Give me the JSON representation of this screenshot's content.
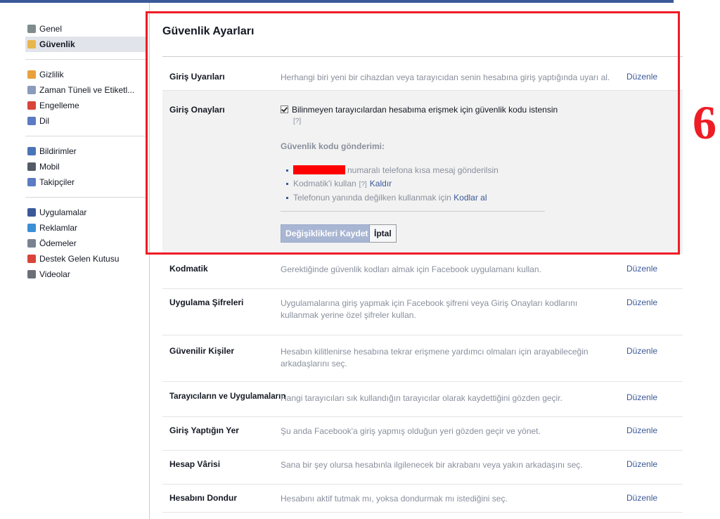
{
  "sidebar": {
    "groups": [
      [
        {
          "label": "Genel",
          "icon": "gears-icon",
          "color": "#7f8c8d",
          "selected": false
        },
        {
          "label": "Güvenlik",
          "icon": "shield-icon",
          "color": "#e9b64d",
          "selected": true
        }
      ],
      [
        {
          "label": "Gizlilik",
          "icon": "lock-icon",
          "color": "#e9a23b",
          "selected": false
        },
        {
          "label": "Zaman Tüneli ve Etiketl...",
          "icon": "timeline-icon",
          "color": "#8a9bbd",
          "selected": false
        },
        {
          "label": "Engelleme",
          "icon": "block-icon",
          "color": "#d9443a",
          "selected": false
        },
        {
          "label": "Dil",
          "icon": "globe-icon",
          "color": "#5b7bc2",
          "selected": false
        }
      ],
      [
        {
          "label": "Bildirimler",
          "icon": "globe-notify-icon",
          "color": "#4a76b8",
          "selected": false
        },
        {
          "label": "Mobil",
          "icon": "mobile-icon",
          "color": "#555b66",
          "selected": false
        },
        {
          "label": "Takipçiler",
          "icon": "rss-icon",
          "color": "#5b7bc2",
          "selected": false
        }
      ],
      [
        {
          "label": "Uygulamalar",
          "icon": "apps-icon",
          "color": "#3b5998",
          "selected": false
        },
        {
          "label": "Reklamlar",
          "icon": "ads-icon",
          "color": "#3b8fd6",
          "selected": false
        },
        {
          "label": "Ödemeler",
          "icon": "payments-icon",
          "color": "#7a8290",
          "selected": false
        },
        {
          "label": "Destek Gelen Kutusu",
          "icon": "lifebuoy-icon",
          "color": "#d9443a",
          "selected": false
        },
        {
          "label": "Videolar",
          "icon": "video-icon",
          "color": "#6a6f78",
          "selected": false
        }
      ]
    ]
  },
  "main": {
    "title": "Güvenlik Ayarları",
    "edit_label": "Düzenle",
    "rows_top": [
      {
        "label": "Giriş Uyarıları",
        "desc": "Herhangi biri yeni bir cihazdan veya tarayıcıdan senin hesabına giriş yaptığında uyarı al."
      }
    ],
    "expanded": {
      "label": "Giriş Onayları",
      "checkbox_label": "Bilinmeyen tarayıcılardan hesabıma erişmek için güvenlik kodu istensin",
      "help": "[?]",
      "sub_title": "Güvenlik kodu gönderimi:",
      "phone_text": "numaralı telefona kısa mesaj gönderilsin",
      "kodmatik_text": "Kodmatik'i kullan",
      "kodmatik_help": "[?]",
      "remove_link": "Kaldır",
      "codes_text": "Telefonun yanında değilken kullanmak için",
      "codes_link": "Kodlar al",
      "save_button": "Değişiklikleri Kaydet",
      "cancel_button": "İptal"
    },
    "rows": [
      {
        "label": "Kodmatik",
        "desc": "Gerektiğinde güvenlik kodları almak için Facebook uygulamanı kullan."
      },
      {
        "label": "Uygulama Şifreleri",
        "desc": "Uygulamalarına giriş yapmak için Facebook şifreni veya Giriş Onayları kodlarını kullanmak yerine özel şifreler kullan."
      },
      {
        "label": "Güvenilir Kişiler",
        "desc": "Hesabın kilitlenirse hesabına tekrar erişmene yardımcı olmaları için arayabileceğin arkadaşlarını seç."
      },
      {
        "label": "Tarayıcıların ve Uygulamaların",
        "desc": "Hangi tarayıcıları sık kullandığın tarayıcılar olarak kaydettiğini gözden geçir."
      },
      {
        "label": "Giriş Yaptığın Yer",
        "desc": "Şu anda Facebook'a giriş yapmış olduğun yeri gözden geçir ve yönet."
      },
      {
        "label": "Hesap Vârisi",
        "desc": "Sana bir şey olursa hesabınla ilgilenecek bir akrabanı veya yakın arkadaşını seç."
      },
      {
        "label": "Hesabını Dondur",
        "desc": "Hesabını aktif tutmak mı, yoksa dondurmak mı istediğini seç."
      }
    ]
  },
  "annotation": {
    "step_number": "6",
    "color": "#ee1c25"
  }
}
